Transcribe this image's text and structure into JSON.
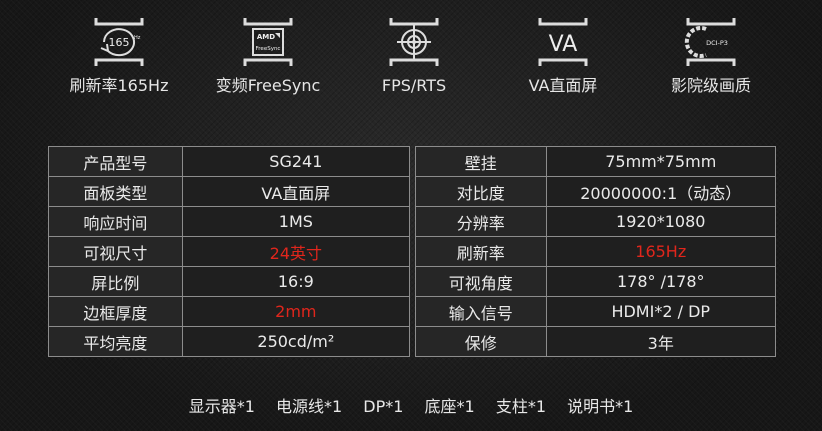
{
  "features": [
    {
      "icon": "refresh-165hz-icon",
      "badge": "165",
      "badge_unit": "Hz",
      "label": "刷新率165Hz"
    },
    {
      "icon": "amd-freesync-icon",
      "badge": "AMD",
      "badge2": "FreeSync",
      "label": "变频FreeSync"
    },
    {
      "icon": "crosshair-target-icon",
      "label": "FPS/RTS"
    },
    {
      "icon": "va-panel-icon",
      "badge": "VA",
      "label": "VA直面屏"
    },
    {
      "icon": "dci-p3-icon",
      "badge": "DCI-P3",
      "label": "影院级画质"
    }
  ],
  "spec_left": [
    {
      "key": "产品型号",
      "value": "SG241"
    },
    {
      "key": "面板类型",
      "value": "VA直面屏"
    },
    {
      "key": "响应时间",
      "value": "1MS"
    },
    {
      "key": "可视尺寸",
      "value": "24英寸",
      "highlight": true
    },
    {
      "key": "屏比例",
      "value": "16:9"
    },
    {
      "key": "边框厚度",
      "value": "2mm",
      "highlight": true
    },
    {
      "key": "平均亮度",
      "value": "250cd/m²"
    }
  ],
  "spec_right": [
    {
      "key": "壁挂",
      "value": "75mm*75mm"
    },
    {
      "key": "对比度",
      "value": "20000000:1（动态）"
    },
    {
      "key": "分辨率",
      "value": "1920*1080"
    },
    {
      "key": "刷新率",
      "value": "165Hz",
      "highlight": true
    },
    {
      "key": "可视角度",
      "value": "178°  /178°"
    },
    {
      "key": "输入信号",
      "value": "HDMI*2 / DP"
    },
    {
      "key": "保修",
      "value": "3年"
    }
  ],
  "accessories": [
    "显示器*1",
    "电源线*1",
    "DP*1",
    "底座*1",
    "支柱*1",
    "说明书*1"
  ],
  "colors": {
    "highlight": "#e0261c",
    "border": "#8c8c8c",
    "text": "#eaeaea"
  }
}
